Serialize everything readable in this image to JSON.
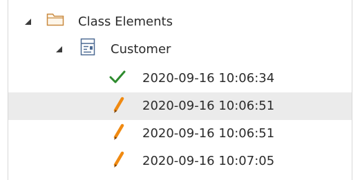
{
  "tree": {
    "package": {
      "label": "Class Elements",
      "icon": "folder-icon",
      "expanded": true
    },
    "element": {
      "label": "Customer",
      "icon": "class-element-icon",
      "expanded": true
    },
    "versions": [
      {
        "timestamp": "2020-09-16 10:06:34",
        "icon": "checkmark-icon",
        "selected": false
      },
      {
        "timestamp": "2020-09-16 10:06:51",
        "icon": "pencil-icon",
        "selected": true
      },
      {
        "timestamp": "2020-09-16 10:06:51",
        "icon": "pencil-icon",
        "selected": false
      },
      {
        "timestamp": "2020-09-16 10:07:05",
        "icon": "pencil-icon",
        "selected": false
      }
    ]
  },
  "colors": {
    "selection_background": "#ebebeb",
    "checkmark": "#2e8b2e",
    "pencil": "#f08a12",
    "folder": "#c9893f"
  }
}
